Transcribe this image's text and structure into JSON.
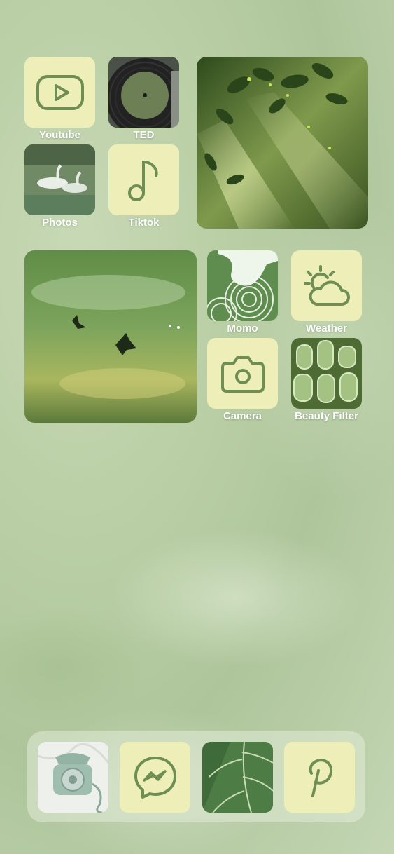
{
  "apps": {
    "youtube": {
      "label": "Youtube",
      "icon": "play-icon"
    },
    "ted": {
      "label": "TED",
      "icon": "vinyl-record-image"
    },
    "photos": {
      "label": "Photos",
      "icon": "swans-image"
    },
    "tiktok": {
      "label": "Tiktok",
      "icon": "music-note-icon"
    },
    "momo": {
      "label": "Momo",
      "icon": "wood-texture-image"
    },
    "weather": {
      "label": "Weather",
      "icon": "sun-cloud-icon"
    },
    "camera": {
      "label": "Camera",
      "icon": "camera-icon"
    },
    "beauty_filter": {
      "label": "Beauty Filter",
      "icon": "glass-texture-image"
    }
  },
  "widgets": {
    "forest_photo": "sunlit-leaves-image",
    "water_photo": "butterflies-water-image"
  },
  "dock": {
    "items": [
      "telephone-image",
      "messenger-icon",
      "leaf-image",
      "pinterest-icon"
    ]
  },
  "colors": {
    "icon_tile_bg": "#eeeeb8",
    "icon_stroke": "#6e8e53",
    "label_text": "#ffffff"
  }
}
